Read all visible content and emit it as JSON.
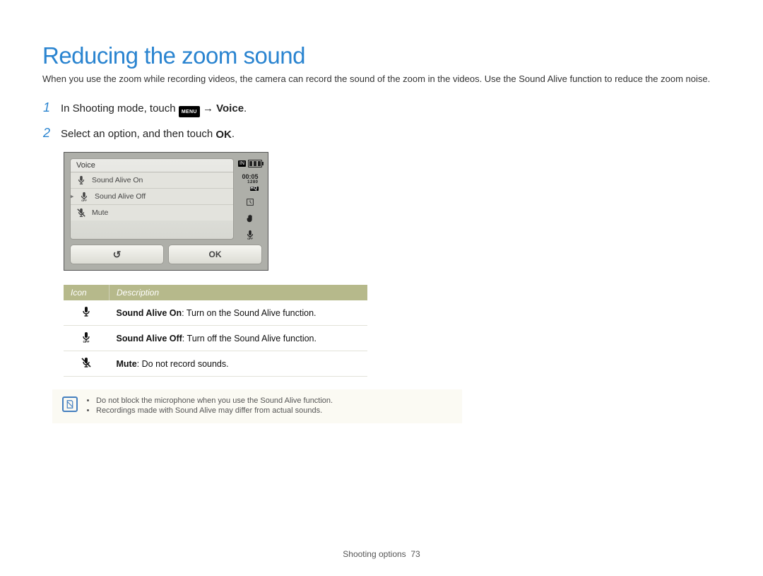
{
  "title": "Reducing the zoom sound",
  "intro": "When you use the zoom while recording videos, the camera can record the sound of the zoom in the videos. Use the Sound Alive function to reduce the zoom noise.",
  "steps": [
    {
      "num": "1",
      "pre": "In Shooting mode, touch ",
      "menu_badge": "MENU",
      "arrow": " → ",
      "bold_suffix": "Voice",
      "after": "."
    },
    {
      "num": "2",
      "pre": "Select an option, and then touch ",
      "ok_glyph": "OK",
      "after": "."
    }
  ],
  "lcd": {
    "header": "Voice",
    "items": [
      {
        "icon": "mic",
        "label": "Sound Alive On",
        "selected": false
      },
      {
        "icon": "mic-off",
        "label": "Sound Alive Off",
        "selected": true
      },
      {
        "icon": "mic-mute",
        "label": "Mute",
        "selected": false
      }
    ],
    "status": {
      "in_label": "IN",
      "time": "00:05",
      "res_top": "1280",
      "res_bot": "HQ"
    },
    "back_glyph": "↺",
    "ok_label": "OK"
  },
  "table": {
    "head_icon": "Icon",
    "head_desc": "Description",
    "rows": [
      {
        "icon": "mic",
        "name": "Sound Alive On",
        "desc": ": Turn on the Sound Alive function."
      },
      {
        "icon": "mic-off",
        "name": "Sound Alive Off",
        "desc": ": Turn off the Sound Alive function."
      },
      {
        "icon": "mic-mute",
        "name": "Mute",
        "desc": ": Do not record sounds."
      }
    ]
  },
  "notes": [
    "Do not block the microphone when you use the Sound Alive function.",
    "Recordings made with Sound Alive may differ from actual sounds."
  ],
  "footer": {
    "section": "Shooting options",
    "page": "73"
  }
}
